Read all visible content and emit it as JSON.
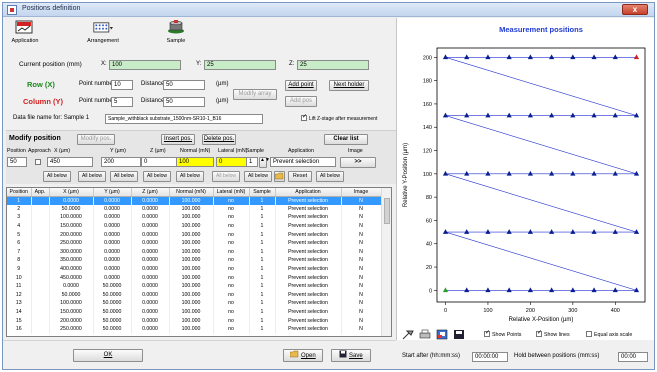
{
  "window": {
    "title": "Positions definition",
    "close": "x"
  },
  "toolbar": {
    "application": "Application",
    "arrangement": "Arrangement",
    "sample": "Sample"
  },
  "current_position": {
    "label": "Current position (mm)",
    "x_label": "X:",
    "x": "100",
    "y_label": "Y:",
    "y": "25",
    "z_label": "Z:",
    "z": "25"
  },
  "row": {
    "title": "Row (X)",
    "point_number_label": "Point number",
    "point_number": "10",
    "distance_label": "Distance",
    "distance": "50",
    "unit": "(µm)"
  },
  "column": {
    "title": "Column (Y)",
    "point_number_label": "Point number",
    "point_number": "5",
    "distance_label": "Distance",
    "distance": "50",
    "unit": "(µm)"
  },
  "array_buttons": {
    "modify_array": "Modify array",
    "add_point": "Add point",
    "add_pos": "Add pos",
    "next_holder": "Next holder"
  },
  "data_file": {
    "label": "Data file name for: Sample 1",
    "value": "Sample_withblack substrate_1500nm-SR10-1_B16",
    "checkbox_label": "Lift Z-stage after measurement",
    "checked": true
  },
  "modify": {
    "title": "Modify position",
    "modify_pos": "Modify pos.",
    "insert_pos": "Insert pos.",
    "delete_pos": "Delete pos.",
    "clear_list": "Clear list",
    "headers": [
      "Position",
      "Approach",
      "X (µm)",
      "Y (µm)",
      "Z (µm)",
      "Normal (mN)",
      "Lateral (mN)",
      "Sample",
      "Application",
      "Image"
    ],
    "values": {
      "position": "50",
      "x": "450",
      "y": "200",
      "z": "0",
      "normal": "100",
      "lateral": "0",
      "sample": "1",
      "application": "Prevent selection",
      "image": ">>"
    },
    "all_below": "All below",
    "reset": "Reset"
  },
  "table": {
    "headers": [
      "Position",
      "App.",
      "X (µm)",
      "Y (µm)",
      "Z (µm)",
      "Normal (mN)",
      "Lateral (mN)",
      "Sample",
      "Application",
      "Image"
    ],
    "rows": [
      [
        "1",
        "",
        "0.0000",
        "0.0000",
        "0.0000",
        "100.000",
        "no",
        "1",
        "Prevent selection",
        "N"
      ],
      [
        "2",
        "",
        "50.0000",
        "0.0000",
        "0.0000",
        "100.000",
        "no",
        "1",
        "Prevent selection",
        "N"
      ],
      [
        "3",
        "",
        "100.0000",
        "0.0000",
        "0.0000",
        "100.000",
        "no",
        "1",
        "Prevent selection",
        "N"
      ],
      [
        "4",
        "",
        "150.0000",
        "0.0000",
        "0.0000",
        "100.000",
        "no",
        "1",
        "Prevent selection",
        "N"
      ],
      [
        "5",
        "",
        "200.0000",
        "0.0000",
        "0.0000",
        "100.000",
        "no",
        "1",
        "Prevent selection",
        "N"
      ],
      [
        "6",
        "",
        "250.0000",
        "0.0000",
        "0.0000",
        "100.000",
        "no",
        "1",
        "Prevent selection",
        "N"
      ],
      [
        "7",
        "",
        "300.0000",
        "0.0000",
        "0.0000",
        "100.000",
        "no",
        "1",
        "Prevent selection",
        "N"
      ],
      [
        "8",
        "",
        "350.0000",
        "0.0000",
        "0.0000",
        "100.000",
        "no",
        "1",
        "Prevent selection",
        "N"
      ],
      [
        "9",
        "",
        "400.0000",
        "0.0000",
        "0.0000",
        "100.000",
        "no",
        "1",
        "Prevent selection",
        "N"
      ],
      [
        "10",
        "",
        "450.0000",
        "0.0000",
        "0.0000",
        "100.000",
        "no",
        "1",
        "Prevent selection",
        "N"
      ],
      [
        "11",
        "",
        "0.0000",
        "50.0000",
        "0.0000",
        "100.000",
        "no",
        "1",
        "Prevent selection",
        "N"
      ],
      [
        "12",
        "",
        "50.0000",
        "50.0000",
        "0.0000",
        "100.000",
        "no",
        "1",
        "Prevent selection",
        "N"
      ],
      [
        "13",
        "",
        "100.0000",
        "50.0000",
        "0.0000",
        "100.000",
        "no",
        "1",
        "Prevent selection",
        "N"
      ],
      [
        "14",
        "",
        "150.0000",
        "50.0000",
        "0.0000",
        "100.000",
        "no",
        "1",
        "Prevent selection",
        "N"
      ],
      [
        "15",
        "",
        "200.0000",
        "50.0000",
        "0.0000",
        "100.000",
        "no",
        "1",
        "Prevent selection",
        "N"
      ],
      [
        "16",
        "",
        "250.0000",
        "50.0000",
        "0.0000",
        "100.000",
        "no",
        "1",
        "Prevent selection",
        "N"
      ]
    ]
  },
  "footer": {
    "ok": "OK",
    "open": "Open",
    "save": "Save"
  },
  "chart_options": {
    "show_points": "Show Points",
    "show_lines": "Show lines",
    "equal_axis": "Equal axis scale",
    "show_points_on": true,
    "show_lines_on": true,
    "equal_axis_on": false
  },
  "timing": {
    "start_label": "Start after (hh:mm:ss)",
    "start": "00:00:00",
    "hold_label": "Hold between positions (mm:ss)",
    "hold": "00:00"
  },
  "colors": {
    "selected_row": "#3399ff",
    "chart_title": "#1f3bd0",
    "line": "#2030d0",
    "marker": "#0a1f8f",
    "start_marker": "#2aa02a",
    "end_marker": "#d02020"
  },
  "chart_data": {
    "type": "scatter",
    "title": "Measurement positions",
    "xlabel": "Relative X-Position (µm)",
    "ylabel": "Relative Y-Position (µm)",
    "xlim": [
      -20,
      470
    ],
    "ylim": [
      -10,
      208
    ],
    "xticks": [
      0,
      100,
      200,
      300,
      400
    ],
    "yticks": [
      0,
      20,
      40,
      60,
      80,
      100,
      120,
      140,
      160,
      180,
      200
    ],
    "x_values": [
      0,
      50,
      100,
      150,
      200,
      250,
      300,
      350,
      400,
      450
    ],
    "y_values": [
      0,
      50,
      100,
      150,
      200
    ],
    "grid": false,
    "path": "row-by-row (raster), each row left to right, diagonal return line between rows",
    "first_point": [
      0,
      0
    ],
    "last_point": [
      450,
      200
    ]
  }
}
